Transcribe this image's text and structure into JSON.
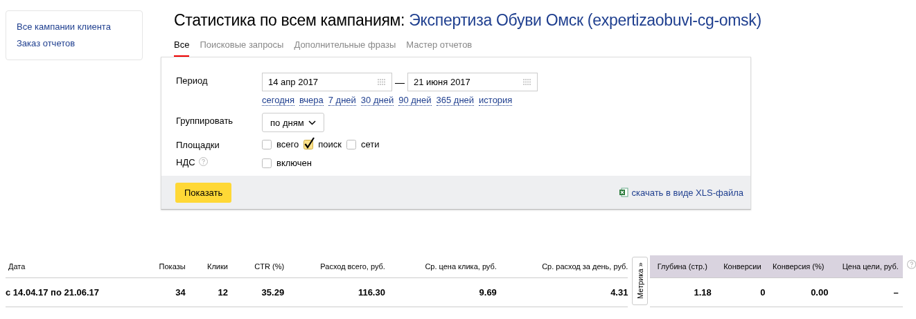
{
  "sidebar": {
    "links": [
      "Все кампании клиента",
      "Заказ отчетов"
    ]
  },
  "title": {
    "text": "Статистика по всем кампаниям:",
    "campaign": "Экспертиза Обуви Омск (expertizaobuvi-cg-omsk)"
  },
  "tabs": [
    {
      "label": "Все",
      "selected": true
    },
    {
      "label": "Поисковые запросы",
      "selected": false
    },
    {
      "label": "Дополнительные фразы",
      "selected": false
    },
    {
      "label": "Мастер отчетов",
      "selected": false
    }
  ],
  "form": {
    "period": {
      "label": "Период",
      "from": "14 апр 2017",
      "separator": "—",
      "to": "21 июня 2017",
      "presets": [
        "сегодня",
        "вчера",
        "7 дней",
        "30 дней",
        "90 дней",
        "365 дней",
        "история"
      ]
    },
    "group": {
      "label": "Группировать",
      "value": "по дням"
    },
    "platforms": {
      "label": "Площадки",
      "options": [
        {
          "label": "всего",
          "checked": false
        },
        {
          "label": "поиск",
          "checked": true
        },
        {
          "label": "сети",
          "checked": false
        }
      ]
    },
    "vat": {
      "label": "НДС",
      "option": {
        "label": "включен",
        "checked": false
      }
    },
    "submit": "Показать",
    "download": "скачать в виде XLS-файла"
  },
  "table": {
    "columns": [
      "Дата",
      "Показы",
      "Клики",
      "CTR (%)",
      "Расход всего, руб.",
      "Ср. цена клика, руб.",
      "Ср. расход за день, руб."
    ],
    "metrika_tab": "Метрика »",
    "metrika_columns": [
      "Глубина (стр.)",
      "Конверсии",
      "Конверсия (%)",
      "Цена цели, руб."
    ],
    "rows": [
      {
        "cells": [
          "с 14.04.17 по 21.06.17",
          "34",
          "12",
          "35.29",
          "116.30",
          "9.69",
          "4.31"
        ],
        "metrika_cells": [
          "1.18",
          "0",
          "0.00",
          "–"
        ]
      }
    ]
  }
}
